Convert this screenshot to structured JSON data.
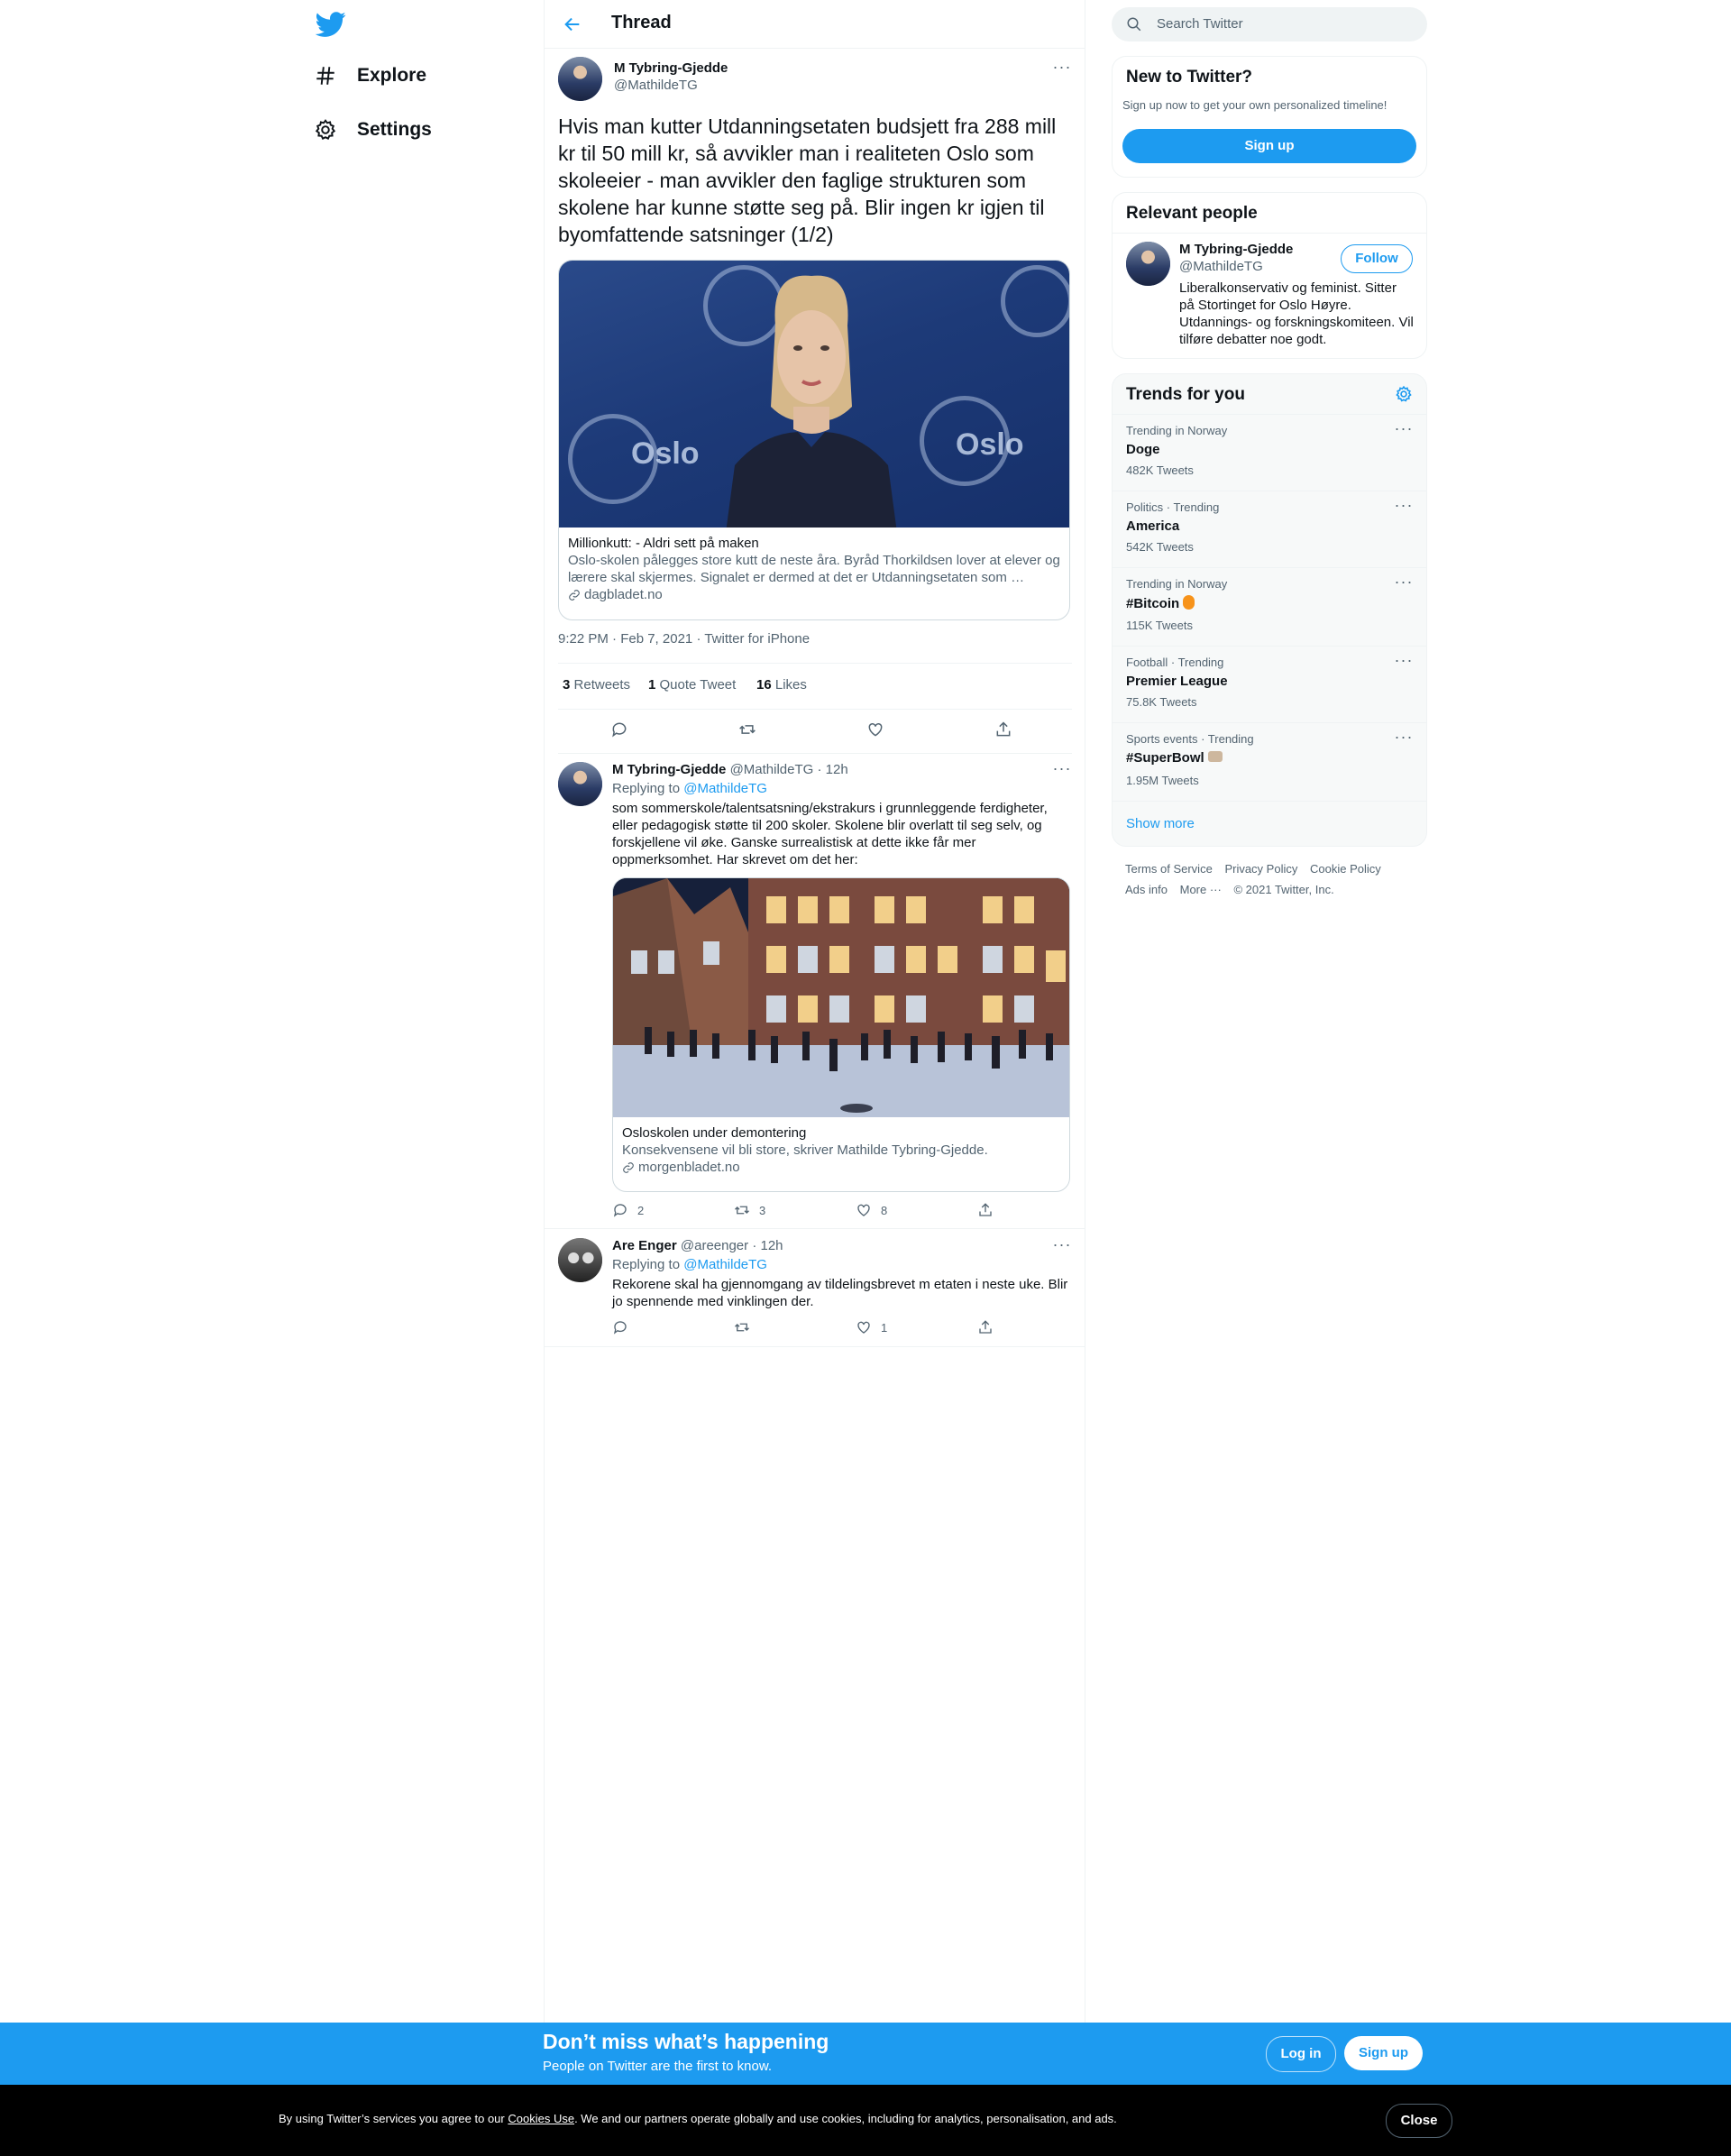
{
  "nav": {
    "items": [
      {
        "label": "Explore",
        "icon": "hashtag-icon"
      },
      {
        "label": "Settings",
        "icon": "gear-icon"
      }
    ]
  },
  "header": {
    "title": "Thread"
  },
  "tweet": {
    "author_name": "M Tybring-Gjedde",
    "author_handle": "@MathildeTG",
    "text": "Hvis man kutter Utdanningsetaten budsjett fra 288 mill kr til 50 mill kr, så avvikler man i realiteten Oslo som skoleeier - man avvikler den faglige strukturen som skolene har kunne støtte seg på. Blir ingen kr igjen til byomfattende satsninger (1/2)",
    "card": {
      "photo_text": "Oslo",
      "title": "Millionkutt: - Aldri sett på maken",
      "description": "Oslo-skolen pålegges store kutt de neste åra. Byråd Thorkildsen lover at elever og lærere skal skjermes. Signalet er dermed at det er Utdanningsetaten som …",
      "domain": "dagbladet.no"
    },
    "timestamp": "9:22 PM · Feb 7, 2021",
    "source": "Twitter for iPhone",
    "stats": {
      "retweets": "3",
      "retweets_label": "Retweets",
      "quotes": "1",
      "quotes_label": "Quote Tweet",
      "likes": "16",
      "likes_label": "Likes"
    }
  },
  "replies": [
    {
      "author_name": "M Tybring-Gjedde",
      "author_handle": "@MathildeTG",
      "time": "12h",
      "replying_prefix": "Replying to",
      "replying_to": "@MathildeTG",
      "text": "som sommerskole/talentsatsning/ekstrakurs i grunnleggende ferdigheter, eller pedagogisk støtte til 200 skoler. Skolene blir overlatt til seg selv, og forskjellene vil øke. Ganske surrealistisk at dette ikke får mer oppmerksomhet. Har skrevet om det her:",
      "card": {
        "title": "Osloskolen under demontering",
        "description": "Konsekvensene vil bli store, skriver Mathilde Tybring-Gjedde.",
        "domain": "morgenbladet.no"
      },
      "counts": {
        "replies": "2",
        "retweets": "3",
        "likes": "8"
      }
    },
    {
      "author_name": "Are Enger",
      "author_handle": "@areenger",
      "time": "12h",
      "replying_prefix": "Replying to",
      "replying_to": "@MathildeTG",
      "text": "Rekorene skal ha gjennomgang av tildelingsbrevet m etaten i neste uke. Blir jo spennende med vinklingen der.",
      "counts": {
        "replies": "",
        "retweets": "",
        "likes": "1"
      }
    }
  ],
  "sidebar": {
    "search_placeholder": "Search Twitter",
    "new_to_twitter": {
      "title": "New to Twitter?",
      "subtitle": "Sign up now to get your own personalized timeline!",
      "button": "Sign up"
    },
    "relevant_people": {
      "title": "Relevant people",
      "name": "M Tybring-Gjedde",
      "handle": "@MathildeTG",
      "follow": "Follow",
      "bio": "Liberalkonservativ og feminist. Sitter på Stortinget for Oslo Høyre. Utdannings- og forskningskomiteen. Vil tilføre debatter noe godt."
    },
    "trends": {
      "title": "Trends for you",
      "items": [
        {
          "category": "Trending in Norway",
          "name": "Doge",
          "count": "482K Tweets"
        },
        {
          "category": "Politics · Trending",
          "name": "America",
          "count": "542K Tweets"
        },
        {
          "category": "Trending in Norway",
          "name": "#Bitcoin",
          "count": "115K Tweets"
        },
        {
          "category": "Football · Trending",
          "name": "Premier League",
          "count": "75.8K Tweets"
        },
        {
          "category": "Sports events · Trending",
          "name": "#SuperBowl",
          "count": "1.95M Tweets"
        }
      ],
      "show_more": "Show more"
    },
    "footer": {
      "terms": "Terms of Service",
      "privacy": "Privacy Policy",
      "cookie": "Cookie Policy",
      "ads": "Ads info",
      "more": "More ···",
      "copyright": "© 2021 Twitter, Inc."
    }
  },
  "bottom_bar": {
    "title": "Don’t miss what’s happening",
    "subtitle": "People on Twitter are the first to know.",
    "login": "Log in",
    "signup": "Sign up"
  },
  "cookie_banner": {
    "text_before": "By using Twitter’s services you agree to our ",
    "link": "Cookies Use",
    "text_after": ". We and our partners operate globally and use cookies, including for analytics, personalisation, and ads.",
    "close": "Close"
  },
  "colors": {
    "accent": "#1d9bf0",
    "text": "#0f1419",
    "secondary": "#536471",
    "border": "#eff3f4"
  }
}
